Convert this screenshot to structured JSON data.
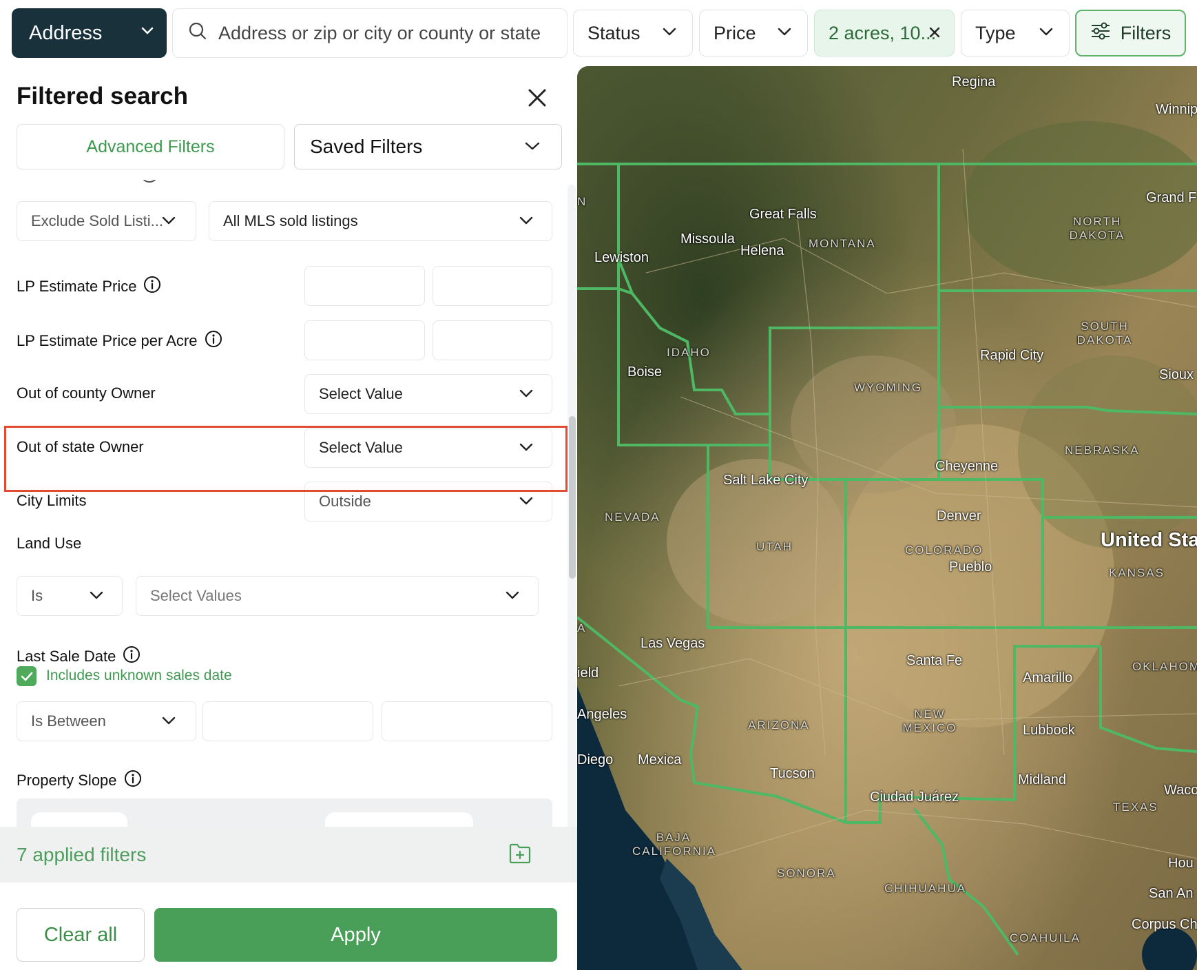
{
  "topbar": {
    "address_label": "Address",
    "search_placeholder": "Address or zip or city or county or state",
    "status_label": "Status",
    "price_label": "Price",
    "acreage_label": "2 acres, 10...",
    "type_label": "Type",
    "filters_label": "Filters"
  },
  "panel": {
    "title": "Filtered search",
    "tab_advanced": "Advanced Filters",
    "tab_saved": "Saved Filters"
  },
  "filters": {
    "sold_mode": "Exclude Sold Listi...",
    "sold_source": "All MLS sold listings",
    "lp_estimate_price": "LP Estimate Price",
    "lp_estimate_price_per_acre": "LP Estimate Price per Acre",
    "out_of_county_owner": "Out of county Owner",
    "out_of_county_value": "Select Value",
    "out_of_state_owner": "Out of state Owner",
    "out_of_state_value": "Select Value",
    "city_limits": "City Limits",
    "city_limits_value": "Outside",
    "land_use": "Land Use",
    "land_use_operator": "Is",
    "land_use_placeholder": "Select Values",
    "last_sale_date": "Last Sale Date",
    "includes_unknown": "Includes unknown sales date",
    "last_sale_operator": "Is Between",
    "property_slope": "Property Slope"
  },
  "footer": {
    "applied_count": "7 applied filters",
    "clear_label": "Clear all",
    "apply_label": "Apply"
  },
  "map": {
    "cities": [
      "Regina",
      "Winnip",
      "Grand F",
      "Great Falls",
      "Missoula",
      "Helena",
      "Lewiston",
      "Boise",
      "Rapid City",
      "Sioux",
      "Cheyenne",
      "Salt Lake City",
      "Denver",
      "Pueblo",
      "Las Vegas",
      "ield",
      "Angeles",
      "Diego",
      "Mexica",
      "Santa Fe",
      "Amarillo",
      "Lubbock",
      "Midland",
      "Waco",
      "Tucson",
      "Ciudad Juárez",
      "Hou",
      "San An",
      "Corpus Ch"
    ],
    "states": [
      "MONTANA",
      "NORTH DAKOTA",
      "SOUTH DAKOTA",
      "IDAHO",
      "WYOMING",
      "NEBRASKA",
      "NEVADA",
      "UTAH",
      "COLORADO",
      "KANSAS",
      "ARIZONA",
      "NEW MEXICO",
      "OKLAHOM",
      "TEXAS",
      "BAJA CALIFORNIA",
      "SONORA",
      "CHIHUAHUA",
      "COAHUILA"
    ],
    "country": "United Stat",
    "state_code_n": "N",
    "state_code_a": "A"
  },
  "colors": {
    "primary_green": "#4a9f58",
    "dark_navy": "#18313a",
    "highlight_red": "#e14b34",
    "border_green": "#4fb864"
  }
}
